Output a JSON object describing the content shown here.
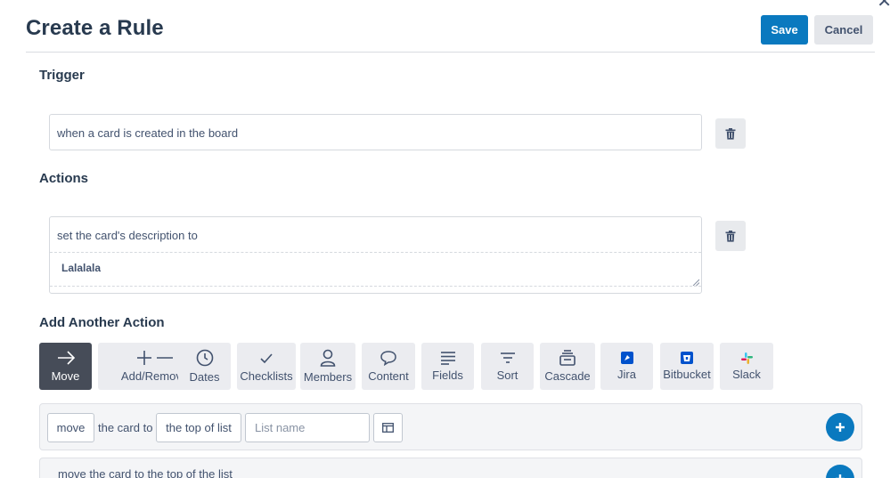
{
  "header": {
    "title": "Create a Rule",
    "save_label": "Save",
    "cancel_label": "Cancel"
  },
  "trigger": {
    "section_label": "Trigger",
    "text": "when a card is created in the board"
  },
  "actions": {
    "section_label": "Actions",
    "text": "set the card's description to",
    "description_value": "Lalalala"
  },
  "add_another": {
    "section_label": "Add Another Action",
    "tiles": [
      {
        "label": "Move",
        "icon": "arrow-right-icon",
        "active": true
      },
      {
        "label": "Add/Remove",
        "icon": "plus-minus-icon"
      },
      {
        "label": "Dates",
        "icon": "clock-icon"
      },
      {
        "label": "Checklists",
        "icon": "check-icon"
      },
      {
        "label": "Members",
        "icon": "person-icon"
      },
      {
        "label": "Content",
        "icon": "speech-bubble-icon"
      },
      {
        "label": "Fields",
        "icon": "lines-icon"
      },
      {
        "label": "Sort",
        "icon": "sort-icon"
      },
      {
        "label": "Cascade",
        "icon": "cascade-icon"
      },
      {
        "label": "Jira",
        "icon": "jira-icon"
      },
      {
        "label": "Bitbucket",
        "icon": "bitbucket-icon"
      },
      {
        "label": "Slack",
        "icon": "slack-icon"
      }
    ]
  },
  "move_row": {
    "verb": "move",
    "text_1": "the card to",
    "position": "the top of list",
    "list_placeholder": "List name"
  },
  "second_row": {
    "text": "move the card to the top of the list"
  },
  "colors": {
    "primary": "#0a79bf",
    "active_tile": "#464c58",
    "tile_bg": "#ebecf0"
  }
}
